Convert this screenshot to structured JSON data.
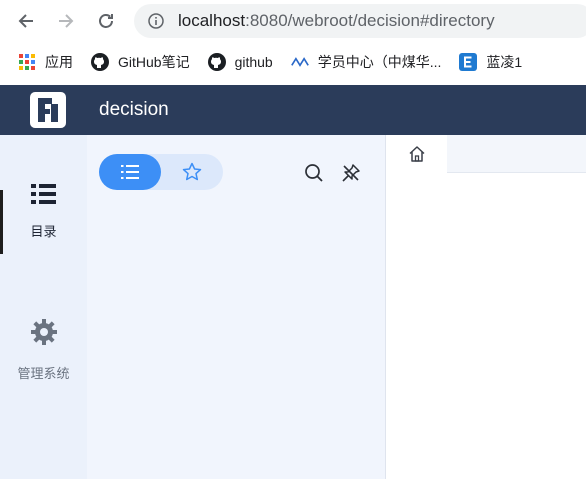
{
  "browser": {
    "url_host": "localhost",
    "url_rest": ":8080/webroot/decision#directory",
    "bookmarks": [
      {
        "label": "应用",
        "icon": "apps-grid-icon"
      },
      {
        "label": "GitHub笔记",
        "icon": "github-icon"
      },
      {
        "label": "github",
        "icon": "github-icon"
      },
      {
        "label": "学员中心（中煤华...",
        "icon": "ekp-logo-icon"
      },
      {
        "label": "蓝凌1",
        "icon": "e-logo-icon"
      }
    ]
  },
  "app": {
    "title": "decision",
    "brand_color": "#2b3c5a",
    "accent_color": "#3d8ff6"
  },
  "leftnav": {
    "items": [
      {
        "label": "目录",
        "icon": "list-icon",
        "active": true
      },
      {
        "label": "管理系统",
        "icon": "gear-icon",
        "active": false
      }
    ]
  },
  "panel": {
    "toggle": {
      "active": "list-icon",
      "inactive": "star-icon"
    },
    "tools": [
      "search-icon",
      "unpin-icon"
    ]
  },
  "content": {
    "tabs": [
      {
        "icon": "home-icon"
      }
    ]
  }
}
